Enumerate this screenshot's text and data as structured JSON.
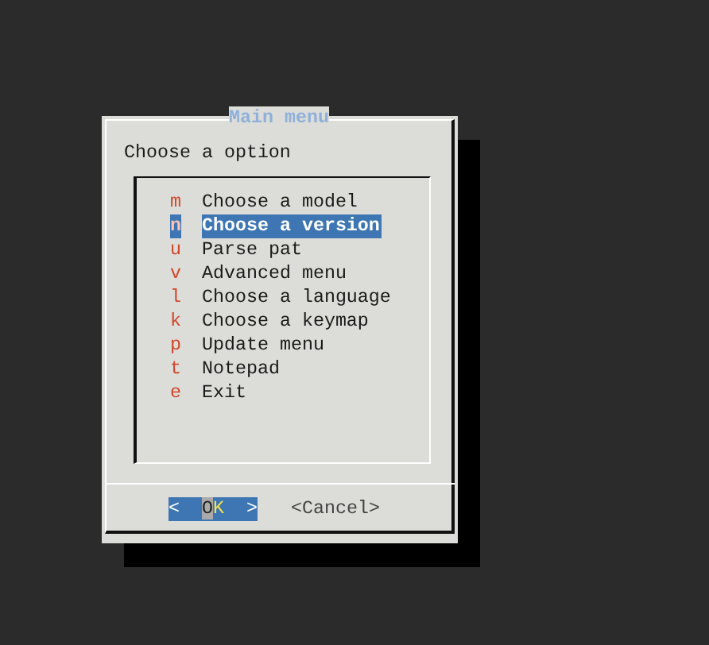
{
  "dialog": {
    "title": "Main menu",
    "prompt": "Choose a option"
  },
  "menu": [
    {
      "key": "m",
      "label": "Choose a model",
      "selected": false
    },
    {
      "key": "n",
      "label": "Choose a version",
      "selected": true
    },
    {
      "key": "u",
      "label": "Parse pat",
      "selected": false
    },
    {
      "key": "v",
      "label": "Advanced menu",
      "selected": false
    },
    {
      "key": "l",
      "label": "Choose a language",
      "selected": false
    },
    {
      "key": "k",
      "label": "Choose a keymap",
      "selected": false
    },
    {
      "key": "p",
      "label": "Update menu",
      "selected": false
    },
    {
      "key": "t",
      "label": "Notepad",
      "selected": false
    },
    {
      "key": "e",
      "label": "Exit",
      "selected": false
    }
  ],
  "buttons": [
    {
      "left": "<",
      "label": "OK",
      "right": ">",
      "selected": true
    },
    {
      "left": "<",
      "label": "Cancel",
      "right": ">",
      "selected": false
    }
  ]
}
